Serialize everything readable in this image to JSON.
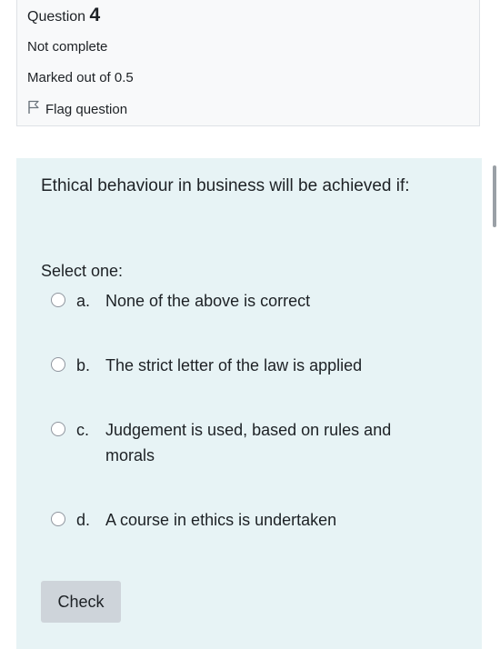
{
  "info": {
    "question_label": "Question",
    "question_number": "4",
    "state": "Not complete",
    "grade": "Marked out of 0.5",
    "flag_label": "Flag question",
    "flag_icon": "flag-icon"
  },
  "question": {
    "text": "Ethical behaviour in business will be achieved if:",
    "prompt": "Select one:",
    "options": [
      {
        "letter": "a.",
        "text": "None of the above is correct",
        "selected": false
      },
      {
        "letter": "b.",
        "text": "The strict letter of the law is applied",
        "selected": false
      },
      {
        "letter": "c.",
        "text": "Judgement is used, based on rules and morals",
        "selected": false
      },
      {
        "letter": "d.",
        "text": "A course in ethics is undertaken",
        "selected": false
      }
    ]
  },
  "actions": {
    "check_label": "Check"
  },
  "colors": {
    "info_background": "#f8f9fa",
    "formulation_background": "#e7f3f5",
    "button_background": "#ced4da"
  }
}
